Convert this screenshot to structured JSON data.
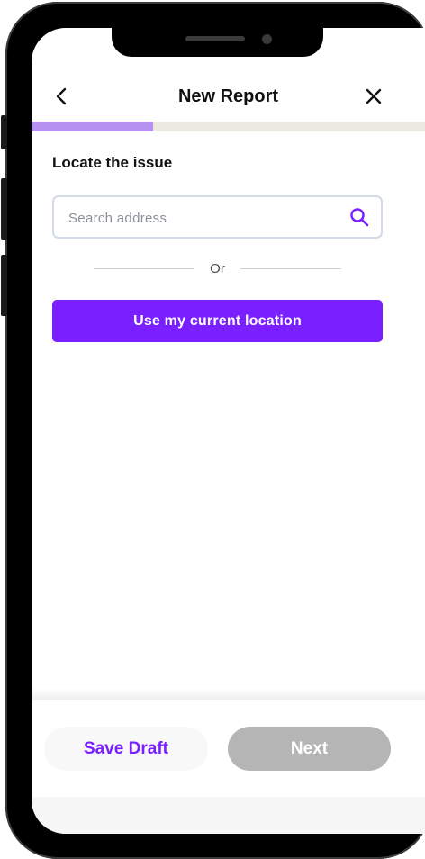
{
  "header": {
    "title": "New Report",
    "back_icon": "chevron-left-icon",
    "close_icon": "close-icon"
  },
  "progress": {
    "fraction": 0.31,
    "fill_color": "#b791f2",
    "track_color": "#ece9e3"
  },
  "section": {
    "title": "Locate the issue"
  },
  "search": {
    "placeholder": "Search address",
    "value": "",
    "icon": "search-icon",
    "icon_color": "#7a1fff"
  },
  "divider": {
    "label": "Or"
  },
  "location_button": {
    "label": "Use my current location",
    "color": "#7a1fff"
  },
  "footer": {
    "save_draft_label": "Save Draft",
    "next_label": "Next",
    "next_disabled_color": "#b5b5b5"
  }
}
